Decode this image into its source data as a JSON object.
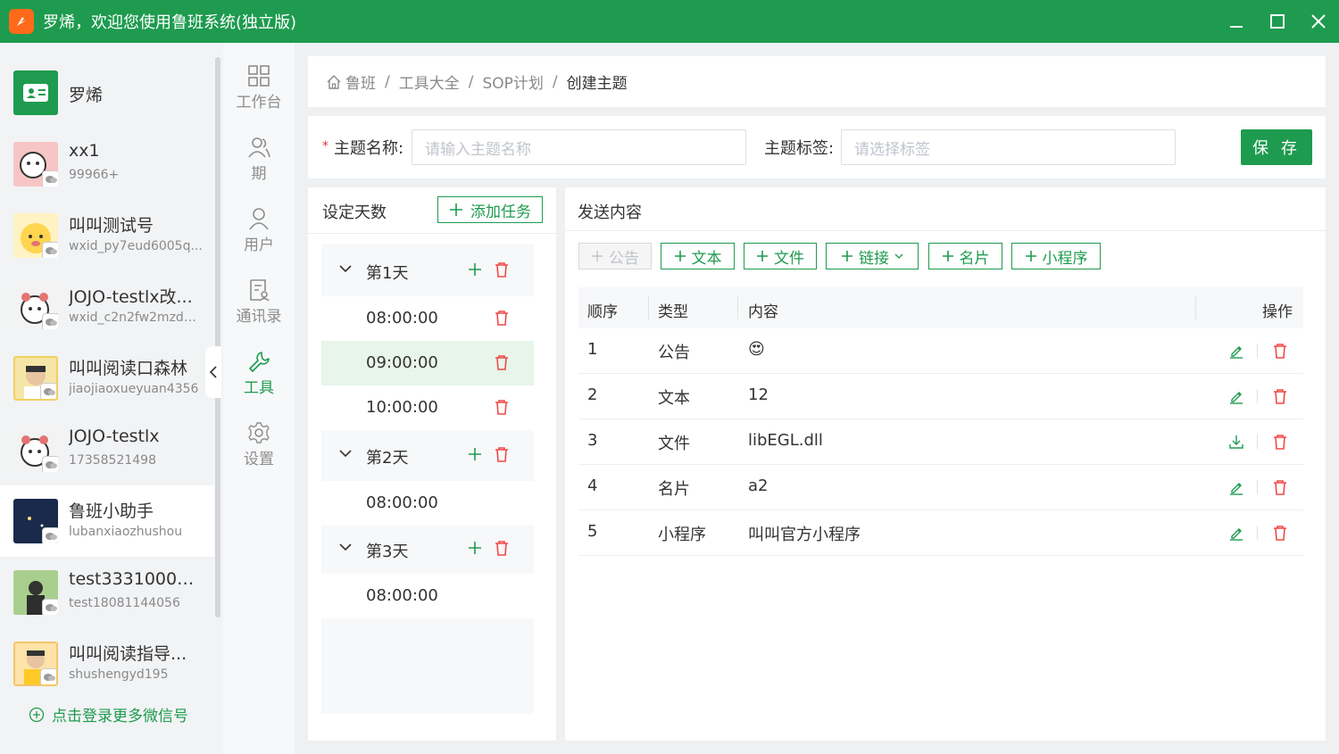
{
  "window": {
    "title": "罗烯，欢迎您使用鲁班系统(独立版)"
  },
  "accounts": [
    {
      "name": "罗烯",
      "sub": "",
      "avatar": "contact-card",
      "color": "#1e9b4f"
    },
    {
      "name": "xx1",
      "sub": "99966+",
      "avatar": "cartoon",
      "color": "#f7c5c5"
    },
    {
      "name": "叫叫测试号",
      "sub": "wxid_py7eud6005q...",
      "avatar": "cartoon",
      "color": "#ffd54f"
    },
    {
      "name": "JOJO-testlx改...",
      "sub": "wxid_c2n2fw2mzd0...",
      "avatar": "cartoon",
      "color": "#f3f3f3"
    },
    {
      "name": "叫叫阅读口森林",
      "sub": "jiaojiaoxueyuan4356",
      "avatar": "photo",
      "color": "#f5e6a8"
    },
    {
      "name": "JOJO-testlx",
      "sub": "17358521498",
      "avatar": "cartoon",
      "color": "#f3f3f3"
    },
    {
      "name": "鲁班小助手",
      "sub": "lubanxiaozhushou",
      "avatar": "photo",
      "color": "#1a2a4a"
    },
    {
      "name": "test33310000...",
      "sub": "test18081144056",
      "avatar": "photo",
      "color": "#7cae6a"
    },
    {
      "name": "叫叫阅读指导...",
      "sub": "shushengyd195",
      "avatar": "photo",
      "color": "#f5c66a"
    }
  ],
  "login_more": "点击登录更多微信号",
  "nav": [
    {
      "label": "工作台",
      "icon": "grid-icon"
    },
    {
      "label": "期",
      "icon": "users-icon"
    },
    {
      "label": "用户",
      "icon": "user-icon"
    },
    {
      "label": "通讯录",
      "icon": "contacts-icon"
    },
    {
      "label": "工具",
      "icon": "wrench-icon"
    },
    {
      "label": "设置",
      "icon": "gear-icon"
    }
  ],
  "breadcrumb": {
    "home": "鲁班",
    "l2": "工具大全",
    "l3": "SOP计划",
    "current": "创建主题",
    "sep": "/"
  },
  "form": {
    "name_label": "主题名称:",
    "name_placeholder": "请输入主题名称",
    "tag_label": "主题标签:",
    "tag_placeholder": "请选择标签",
    "save": "保 存",
    "required_mark": "*"
  },
  "days": {
    "title": "设定天数",
    "add_task": "添加任务",
    "groups": [
      {
        "label": "第1天",
        "times": [
          "08:00:00",
          "09:00:00",
          "10:00:00"
        ]
      },
      {
        "label": "第2天",
        "times": [
          "08:00:00"
        ]
      },
      {
        "label": "第3天",
        "times": [
          "08:00:00"
        ]
      }
    ],
    "selected_time": "09:00:00"
  },
  "content": {
    "title": "发送内容",
    "buttons": [
      "公告",
      "文本",
      "文件",
      "链接",
      "名片",
      "小程序"
    ],
    "columns": [
      "顺序",
      "类型",
      "内容",
      "操作"
    ],
    "rows": [
      {
        "order": "1",
        "type": "公告",
        "content": "😍",
        "action": "edit"
      },
      {
        "order": "2",
        "type": "文本",
        "content": "12",
        "action": "edit"
      },
      {
        "order": "3",
        "type": "文件",
        "content": "libEGL.dll",
        "action": "download"
      },
      {
        "order": "4",
        "type": "名片",
        "content": "a2",
        "action": "edit"
      },
      {
        "order": "5",
        "type": "小程序",
        "content": "叫叫官方小程序",
        "action": "edit"
      }
    ]
  },
  "colors": {
    "accent": "#1e9b4f",
    "danger": "#f04848"
  }
}
